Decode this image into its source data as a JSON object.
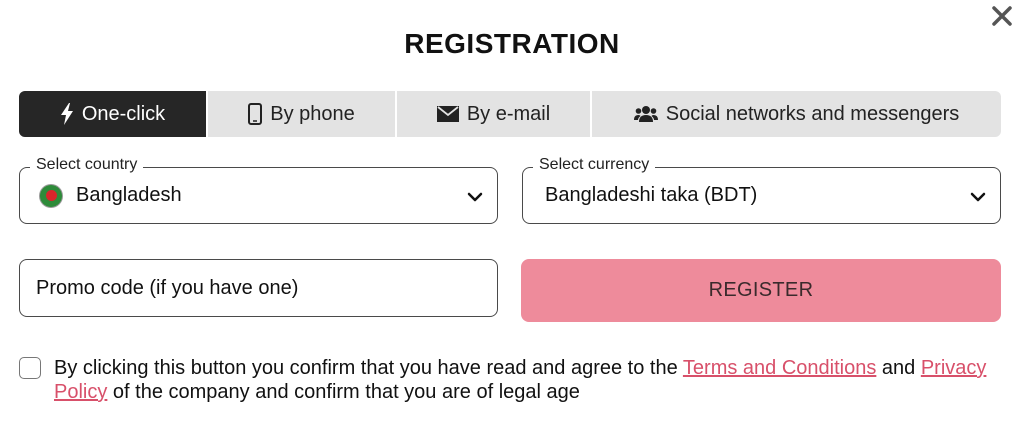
{
  "dialog": {
    "title": "REGISTRATION",
    "close_icon": "close-icon"
  },
  "tabs": [
    {
      "label": "One-click",
      "icon": "lightning-icon",
      "active": true
    },
    {
      "label": "By phone",
      "icon": "phone-icon",
      "active": false
    },
    {
      "label": "By e-mail",
      "icon": "envelope-icon",
      "active": false
    },
    {
      "label": "Social networks and messengers",
      "icon": "users-icon",
      "active": false
    }
  ],
  "country": {
    "legend": "Select country",
    "value": "Bangladesh",
    "flag_icon": "bangladesh-flag-icon"
  },
  "currency": {
    "legend": "Select currency",
    "value": "Bangladeshi taka (BDT)"
  },
  "promo": {
    "placeholder": "Promo code (if you have one)"
  },
  "register_button": {
    "label": "REGISTER"
  },
  "consent": {
    "checked": false,
    "text_before": "By clicking this button you confirm that you have read and agree to the ",
    "terms_link": "Terms and Conditions",
    "text_between": " and ",
    "privacy_link": "Privacy Policy",
    "text_after": " of the company and confirm that you are of legal age"
  },
  "colors": {
    "active_tab": "#262626",
    "tab_bg": "#e3e3e3",
    "register_bg": "#ee8b9b",
    "link": "#d8506a"
  }
}
